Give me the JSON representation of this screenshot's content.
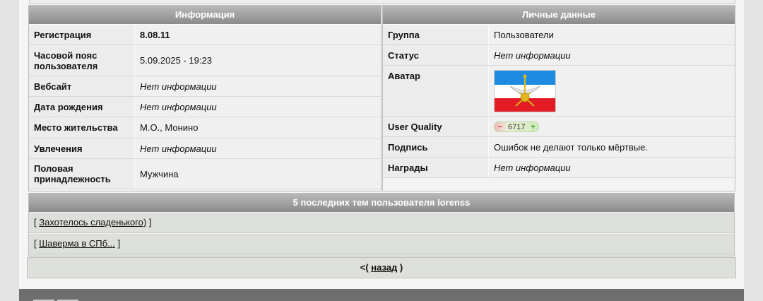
{
  "info": {
    "title": "Информация",
    "rows": [
      {
        "key": "Регистрация",
        "value": "8.08.11"
      },
      {
        "key": "Часовой пояс пользователя",
        "value": "5.09.2025 - 19:23"
      },
      {
        "key": "Вебсайт",
        "value": "Нет информации"
      },
      {
        "key": "Дата рождения",
        "value": "Нет информации"
      },
      {
        "key": "Место жительства",
        "value": "М.О., Монино"
      },
      {
        "key": "Увлечения",
        "value": "Нет информации"
      },
      {
        "key": "Половая принадлежность",
        "value": "Мужчина"
      }
    ]
  },
  "personal": {
    "title": "Личные данные",
    "group_label": "Группа",
    "group_value": "Пользователи",
    "status_label": "Статус",
    "status_value": "Нет информации",
    "avatar_label": "Аватар",
    "avatar_icon": "flag-avatar-icon",
    "quality_label": "User Quality",
    "quality_minus": "−",
    "quality_value": "6717",
    "quality_plus": "+",
    "signature_label": "Подпись",
    "signature_value": "Ошибок не делают только мёртвые.",
    "awards_label": "Награды",
    "awards_value": "Нет информации"
  },
  "topics": {
    "title": "5 последних тем пользователя lorenss",
    "items": [
      {
        "open": "[ ",
        "text": "Захотелось сладенького)",
        "close": " ]"
      },
      {
        "open": "[ ",
        "text": "Шаверма в СПб...",
        "close": " ]"
      }
    ]
  },
  "nav": {
    "back_prefix": "<( ",
    "back_label": "назад",
    "back_suffix": " )"
  },
  "colors": {
    "header_gradient_top": "#b9b9b9",
    "header_gradient_bottom": "#8b8b8b",
    "flag_blue": "#1d8ce0",
    "flag_red": "#e21b25"
  }
}
